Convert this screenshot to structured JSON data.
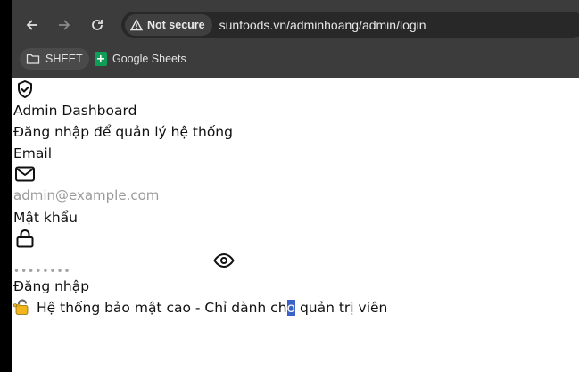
{
  "browser": {
    "security_label": "Not secure",
    "url": "sunfoods.vn/adminhoang/admin/login",
    "bookmarks": [
      {
        "label": "SHEET",
        "icon": "folder-icon"
      },
      {
        "label": "Google Sheets",
        "icon": "google-sheets-icon"
      }
    ]
  },
  "login": {
    "header_icon": "shield-check-icon",
    "title": "Admin Dashboard",
    "subtitle": "Đăng nhập để quản lý hệ thống",
    "email": {
      "label": "Email",
      "icon": "mail-icon",
      "placeholder": "admin@example.com",
      "value": ""
    },
    "password": {
      "label": "Mật khẩu",
      "icon": "lock-icon",
      "masked_value": "••••••••",
      "toggle_icon": "eye-icon"
    },
    "submit_label": "Đăng nhập",
    "footer": {
      "icon": "lock-key-emoji",
      "text_before": "Hệ thống bảo mật cao - Chỉ dành ch",
      "text_selected": "o",
      "text_after": " quản trị viên"
    }
  },
  "colors": {
    "chrome_bg": "#3c3c3c",
    "omnibox_bg": "#282828",
    "selection": "#3b63c7",
    "sheets_green": "#0f9d58"
  }
}
